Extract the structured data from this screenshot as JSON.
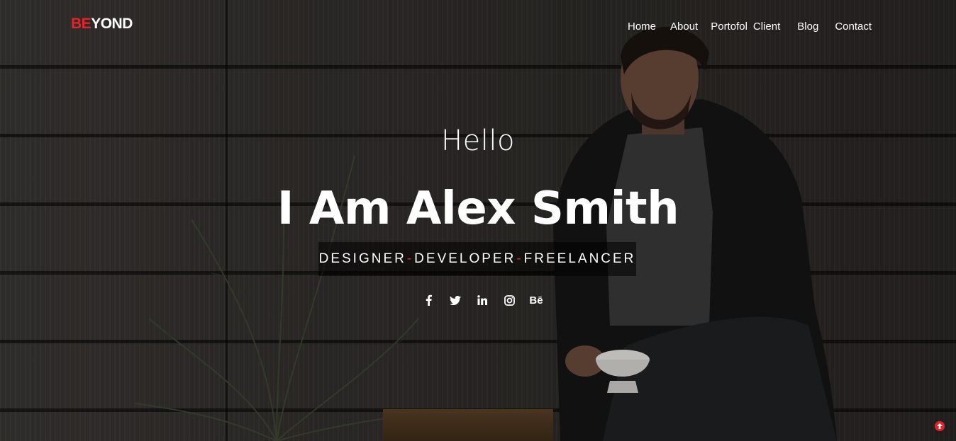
{
  "logo": {
    "accent": "BE",
    "rest": "YOND"
  },
  "nav": [
    {
      "label": "Home"
    },
    {
      "label": "About"
    },
    {
      "label": "Portofol"
    },
    {
      "label": "Client"
    },
    {
      "label": "Blog"
    },
    {
      "label": "Contact"
    }
  ],
  "hero": {
    "greeting": "Hello",
    "headline": "I Am Alex Smith",
    "roles": [
      "DESIGNER",
      "DEVELOPER",
      "FREELANCER"
    ],
    "role_separator": "-"
  },
  "social": [
    {
      "icon": "facebook-icon",
      "glyph": "f"
    },
    {
      "icon": "twitter-icon",
      "glyph": "t"
    },
    {
      "icon": "linkedin-icon",
      "glyph": "in"
    },
    {
      "icon": "instagram-icon",
      "glyph": "ig"
    },
    {
      "icon": "behance-icon",
      "glyph": "Bē"
    }
  ],
  "colors": {
    "accent": "#e3242b",
    "text": "#ffffff"
  }
}
